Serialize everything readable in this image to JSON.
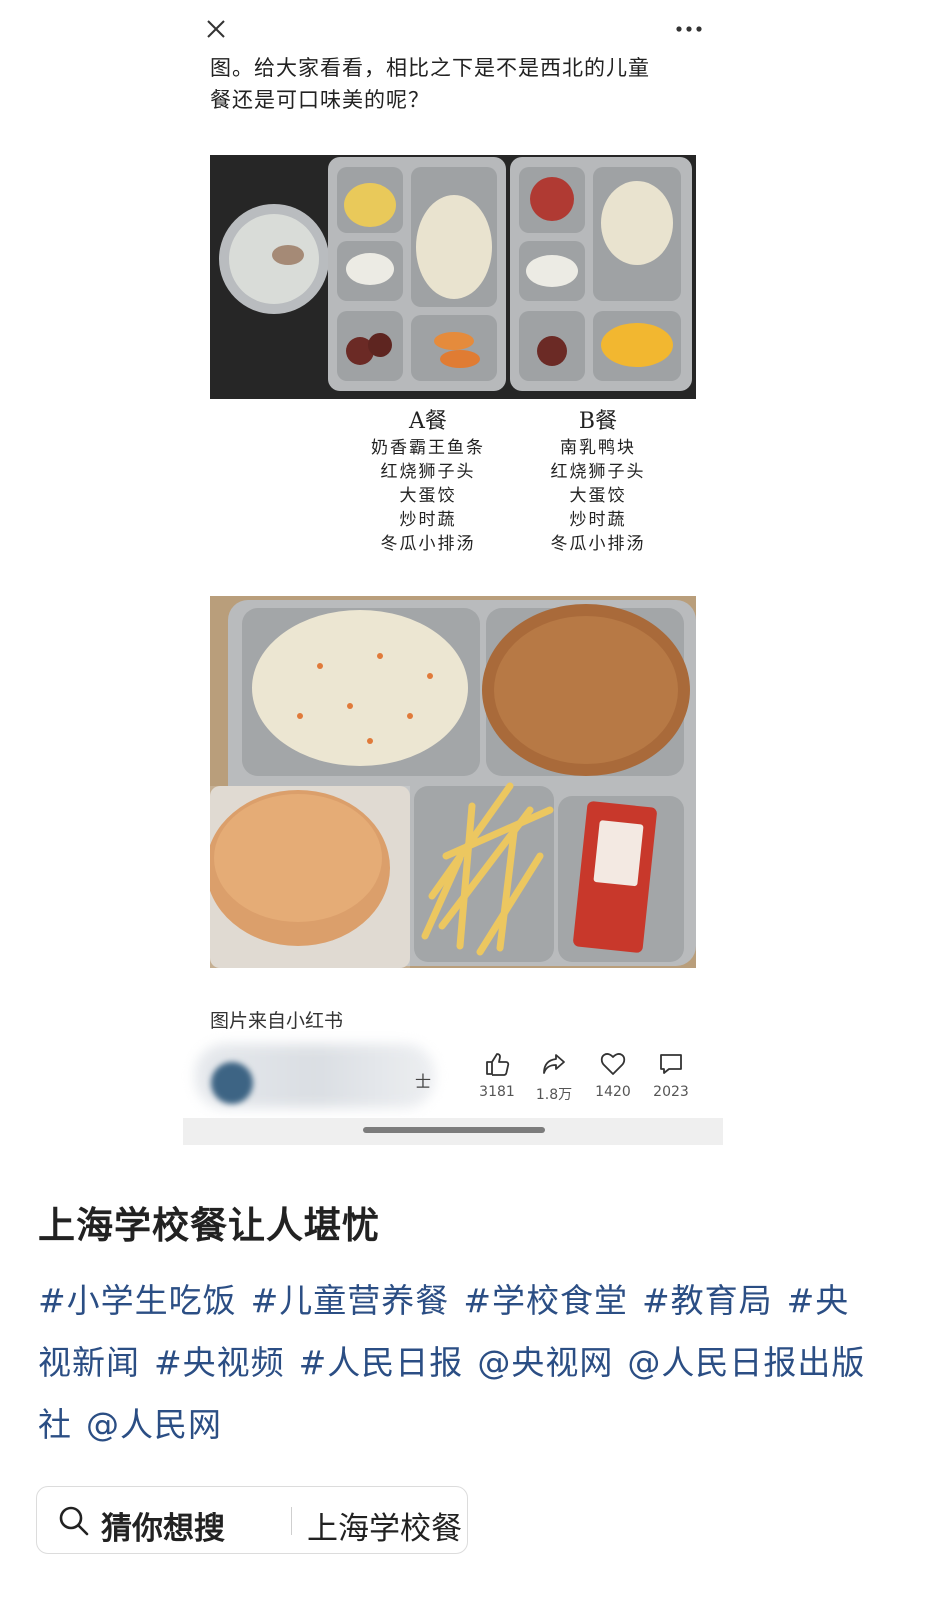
{
  "embed": {
    "intro_line1": "图。给大家看看，相比之下是不是西北的儿童",
    "intro_line2": "餐还是可口味美的呢？",
    "menu_a": {
      "title": "A餐",
      "items": [
        "奶香霸王鱼条",
        "红烧狮子头",
        "大蛋饺",
        "炒时蔬",
        "冬瓜小排汤"
      ]
    },
    "menu_b": {
      "title": "B餐",
      "items": [
        "南乳鸭块",
        "红烧狮子头",
        "大蛋饺",
        "炒时蔬",
        "冬瓜小排汤"
      ]
    },
    "caption": "图片来自小红书",
    "author_tail": "士",
    "actions": {
      "likes": "3181",
      "shares": "1.8万",
      "favorites": "1420",
      "comments": "2023"
    }
  },
  "post": {
    "title": "上海学校餐让人堪忧",
    "tags": [
      "#小学生吃饭",
      "#儿童营养餐",
      "#学校食堂",
      "#教育局",
      "#央视新闻",
      "#央视频",
      "#人民日报",
      "@央视网",
      "@人民日报出版社",
      "@人民网"
    ]
  },
  "suggest": {
    "label": "猜你想搜",
    "query": "上海学校餐"
  },
  "icons": {
    "close": "close-icon",
    "more": "more-icon",
    "like": "thumbs-up-icon",
    "share": "share-icon",
    "favorite": "heart-icon",
    "comment": "comment-icon",
    "search": "search-icon"
  },
  "colors": {
    "tag": "#2b4e84",
    "title": "#222222"
  }
}
